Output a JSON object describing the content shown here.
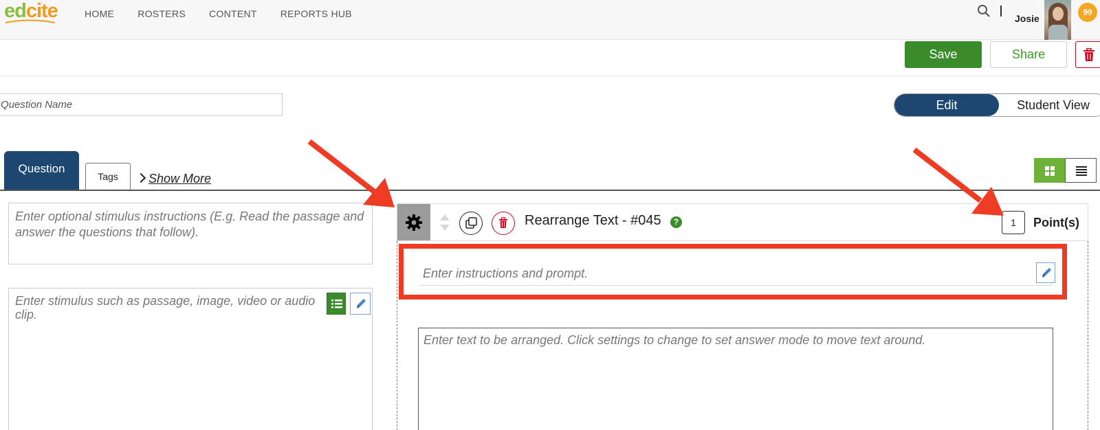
{
  "app": {
    "logo_part1": "ed",
    "logo_part2": "cite"
  },
  "nav": {
    "items": [
      {
        "label": "HOME"
      },
      {
        "label": "ROSTERS"
      },
      {
        "label": "CONTENT"
      },
      {
        "label": "REPORTS HUB"
      }
    ],
    "search_icon": "search-icon",
    "user_name": "Josie",
    "badge_count": "99"
  },
  "toolbar": {
    "save_label": "Save",
    "share_label": "Share",
    "delete_icon": "trash-icon"
  },
  "question_name": {
    "placeholder": "Question Name"
  },
  "view_toggle": {
    "edit_label": "Edit",
    "student_label": "Student View",
    "active": "Edit"
  },
  "tabs": {
    "question_label": "Question",
    "tags_label": "Tags",
    "show_more_label": "Show More"
  },
  "stimulus": {
    "instructions_placeholder": "Enter optional stimulus instructions (E.g. Read the passage and answer the questions that follow).",
    "content_placeholder": "Enter stimulus such as passage, image, video or audio clip."
  },
  "question": {
    "title": "Rearrange Text - #045",
    "help_label": "?",
    "points_value": "1",
    "points_label": "Point(s)",
    "instructions_placeholder": "Enter instructions and prompt.",
    "arrange_placeholder": "Enter text to be arranged. Click settings to change to set answer mode to move text around."
  },
  "colors": {
    "primary_navy": "#1d4670",
    "save_green": "#3a8c2a",
    "annotation_red": "#ee3b24",
    "badge_orange": "#f5a623"
  }
}
